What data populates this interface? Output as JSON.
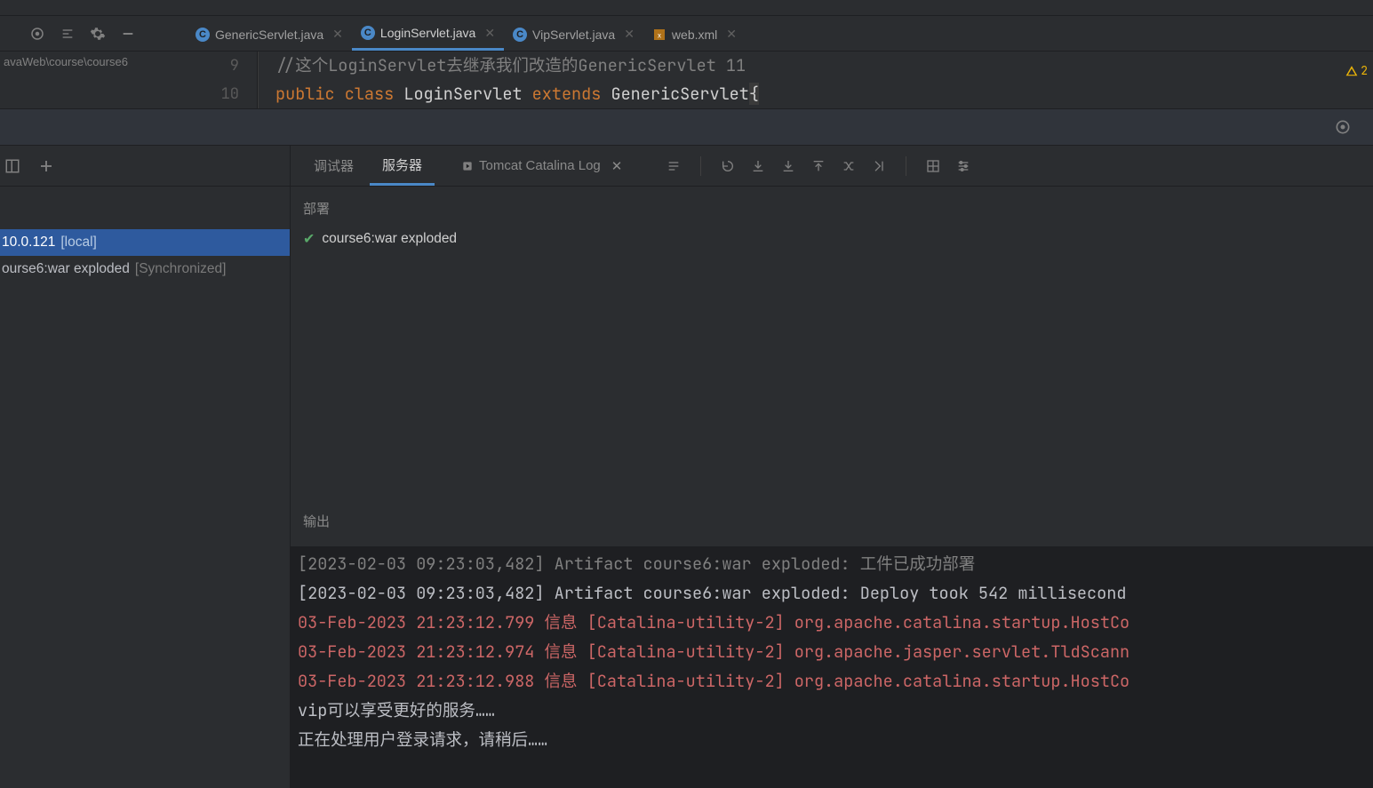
{
  "editorTabs": [
    {
      "name": "GenericServlet.java",
      "active": false,
      "type": "class"
    },
    {
      "name": "LoginServlet.java",
      "active": true,
      "type": "class"
    },
    {
      "name": "VipServlet.java",
      "active": false,
      "type": "class"
    },
    {
      "name": "web.xml",
      "active": false,
      "type": "xml"
    }
  ],
  "breadcrumb": "avaWeb\\course\\course6",
  "gutter": {
    "line9": "9",
    "line10": "10"
  },
  "code": {
    "comment_prefix": "//这个",
    "comment_mid": "LoginServlet",
    "comment_suffix": "去继承我们改造的GenericServlet  11",
    "kw_public": "public",
    "kw_class": "class",
    "cls_name": "LoginServlet",
    "kw_extends": "extends",
    "super_name": "GenericServlet",
    "brace": "{"
  },
  "warnCount": "2",
  "runTabs": {
    "debugger": "调试器",
    "server": "服务器",
    "logLabel": "Tomcat Catalina Log"
  },
  "treeRow1": {
    "main": "10.0.121",
    "suffix": "[local]"
  },
  "treeRow2": {
    "main": "ourse6:war exploded",
    "suffix": "[Synchronized]"
  },
  "deploy": {
    "head": "部署",
    "item": "course6:war exploded"
  },
  "output": {
    "head": "输出"
  },
  "console": {
    "l1a": "[2023-02-03 09:23:03,482]",
    "l1b": "Artifact course6:war exploded: 工件已成功部署",
    "l2a": "[2023-02-03 09:23:03,482]",
    "l2b": "Artifact course6:war exploded: Deploy took 542 millisecond",
    "l3a": "03-Feb-2023 21:23:12.799",
    "l3b": "信息",
    "l3c": "[Catalina-utility-2] org.apache.catalina.startup.HostCo",
    "l4a": "03-Feb-2023 21:23:12.974",
    "l4b": "信息",
    "l4c": "[Catalina-utility-2] org.apache.jasper.servlet.TldScann",
    "l5a": "03-Feb-2023 21:23:12.988",
    "l5b": "信息",
    "l5c": "[Catalina-utility-2] org.apache.catalina.startup.HostCo",
    "l6a": "vip",
    "l6b": "可以享受更好的服务……",
    "l7": "正在处理用户登录请求，请稍后……"
  }
}
